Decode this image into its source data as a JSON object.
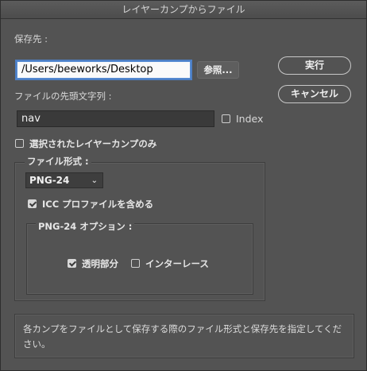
{
  "window": {
    "title": "レイヤーカンプからファイル"
  },
  "destination": {
    "label": "保存先 :",
    "value": "/Users/beeworks/Desktop",
    "browse_label": "参照..."
  },
  "prefix": {
    "label": "ファイルの先頭文字列 :",
    "value": "nav",
    "index_label": "Index",
    "index_checked": false
  },
  "selected_only": {
    "label": "選択されたレイヤーカンプのみ",
    "checked": false
  },
  "buttons": {
    "run_label": "実行",
    "cancel_label": "キャンセル"
  },
  "file_type": {
    "group_label": "ファイル形式 :",
    "selected": "PNG-24",
    "icc_label": "ICC プロファイルを含める",
    "icc_checked": true
  },
  "png_options": {
    "group_label": "PNG-24 オプション :",
    "transparency_label": "透明部分",
    "transparency_checked": true,
    "interlace_label": "インターレース",
    "interlace_checked": false
  },
  "description": "各カンプをファイルとして保存する際のファイル形式と保存先を指定してください。"
}
